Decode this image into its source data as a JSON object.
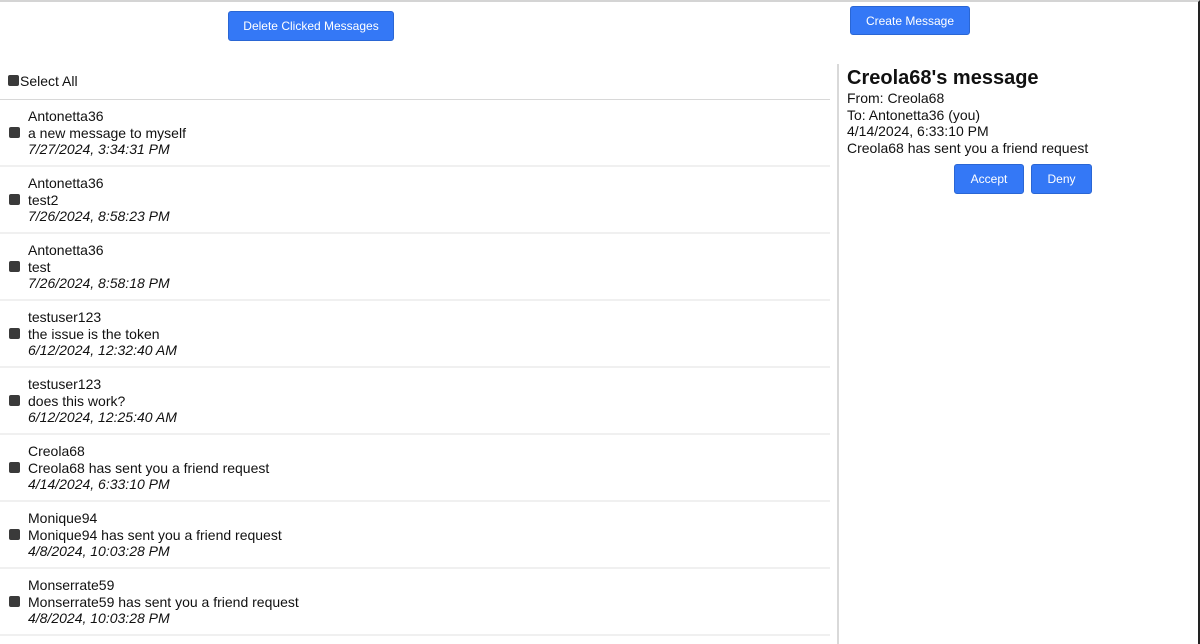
{
  "toolbar": {
    "delete_label": "Delete Clicked Messages",
    "create_label": "Create Message"
  },
  "list": {
    "select_all_label": "Select All",
    "messages": [
      {
        "sender": "Antonetta36",
        "body": "a new message to myself",
        "date": "7/27/2024, 3:34:31 PM"
      },
      {
        "sender": "Antonetta36",
        "body": "test2",
        "date": "7/26/2024, 8:58:23 PM"
      },
      {
        "sender": "Antonetta36",
        "body": "test",
        "date": "7/26/2024, 8:58:18 PM"
      },
      {
        "sender": "testuser123",
        "body": "the issue is the token",
        "date": "6/12/2024, 12:32:40 AM"
      },
      {
        "sender": "testuser123",
        "body": "does this work?",
        "date": "6/12/2024, 12:25:40 AM"
      },
      {
        "sender": "Creola68",
        "body": "Creola68 has sent you a friend request",
        "date": "4/14/2024, 6:33:10 PM"
      },
      {
        "sender": "Monique94",
        "body": "Monique94 has sent you a friend request",
        "date": "4/8/2024, 10:03:28 PM"
      },
      {
        "sender": "Monserrate59",
        "body": "Monserrate59 has sent you a friend request",
        "date": "4/8/2024, 10:03:28 PM"
      }
    ]
  },
  "detail": {
    "title": "Creola68's message",
    "from": "From: Creola68",
    "to": "To: Antonetta36 (you)",
    "date": "4/14/2024, 6:33:10 PM",
    "body": "Creola68 has sent you a friend request",
    "accept_label": "Accept",
    "deny_label": "Deny"
  },
  "colors": {
    "button": "#3478f6",
    "checkbox": "#3a3a3a"
  }
}
